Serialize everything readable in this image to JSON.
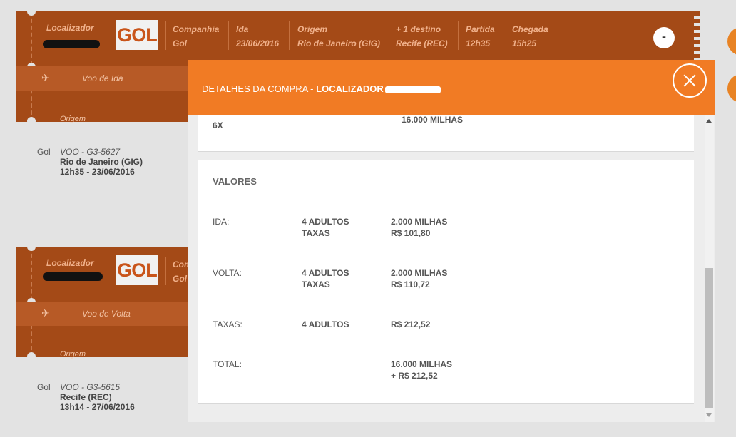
{
  "background": {
    "tickets": [
      {
        "localizador_label": "Localizador",
        "logo_text": "GOL",
        "companhia_label": "Companhia",
        "companhia_value": "Gol",
        "ida_label": "Ida",
        "ida_value": "23/06/2016",
        "origem_label": "Origem",
        "origem_value": "Rio de Janeiro (GIG)",
        "destino_label": "+ 1 destino",
        "destino_value": "Recife (REC)",
        "partida_label": "Partida",
        "partida_value": "12h35",
        "chegada_label": "Chegada",
        "chegada_value": "15h25",
        "collapse_label": "-",
        "band_label": "Voo de Ida",
        "origem_band_label": "Origem",
        "segment": {
          "airline": "Gol",
          "flight": "VOO - G3-5627",
          "city": "Rio de Janeiro (GIG)",
          "time": "12h35 - 23/06/2016"
        }
      },
      {
        "localizador_label": "Localizador",
        "logo_text": "GOL",
        "companhia_label": "Com",
        "companhia_value": "Gol",
        "band_label": "Voo de Volta",
        "origem_band_label": "Origem",
        "segment": {
          "airline": "Gol",
          "flight": "VOO - G3-5615",
          "city": "Recife (REC)",
          "time": "13h14 - 27/06/2016"
        }
      }
    ]
  },
  "modal": {
    "title_prefix": "DETALHES DA COMPRA - ",
    "title_bold": "LOCALIZADOR",
    "close_icon": "close-x-icon",
    "top_row": {
      "left": "6X",
      "right": "16.000 MILHAS"
    },
    "valores": {
      "title": "VALORES",
      "rows": [
        {
          "label": "IDA:",
          "qty": [
            "4 ADULTOS",
            "TAXAS"
          ],
          "value": [
            "2.000 MILHAS",
            "R$ 101,80"
          ]
        },
        {
          "label": "VOLTA:",
          "qty": [
            "4 ADULTOS",
            "TAXAS"
          ],
          "value": [
            "2.000 MILHAS",
            "R$ 110,72"
          ]
        },
        {
          "label": "TAXAS:",
          "qty": [
            "4 ADULTOS"
          ],
          "value": [
            "R$ 212,52"
          ]
        },
        {
          "label": "TOTAL:",
          "qty": [],
          "value": [
            "16.000 MILHAS",
            "+ R$ 212,52"
          ]
        }
      ]
    }
  },
  "colors": {
    "modal_header": "#f17b24",
    "ticket_bg": "#a44a17",
    "overlay": "#e3e3e3"
  }
}
